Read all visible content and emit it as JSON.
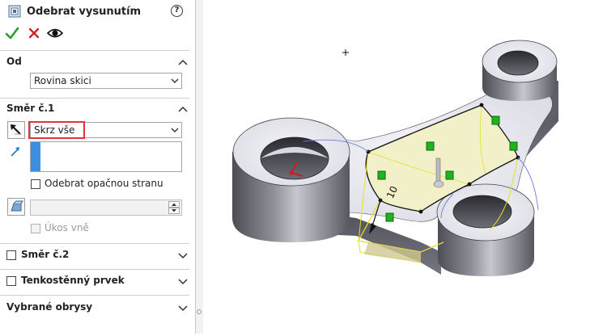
{
  "feature": {
    "title": "Odebrat vysunutím",
    "help_label": "?"
  },
  "actions": {
    "ok_icon": "checkmark-icon",
    "cancel_icon": "close-icon",
    "preview_icon": "eye-icon"
  },
  "from": {
    "title": "Od",
    "value": "Rovina skici"
  },
  "direction1": {
    "title": "Směr č.1",
    "end_condition": "Skrz vše",
    "flip_side_label": "Odebrat opačnou stranu",
    "draft_outward_label": "Úkos vně"
  },
  "direction2": {
    "title": "Směr č.2"
  },
  "thin_feature": {
    "title": "Tenkostěnný prvek"
  },
  "selected_contours": {
    "title": "Vybrané obrysy"
  },
  "viewport": {
    "depth_label": "10"
  },
  "colors": {
    "accent_red": "#e0343a",
    "accent_blue": "#3c8fe0",
    "ok_green": "#2a9d2a",
    "preview_yellow": "#f2f0c8",
    "handle_green": "#1fb31f"
  }
}
